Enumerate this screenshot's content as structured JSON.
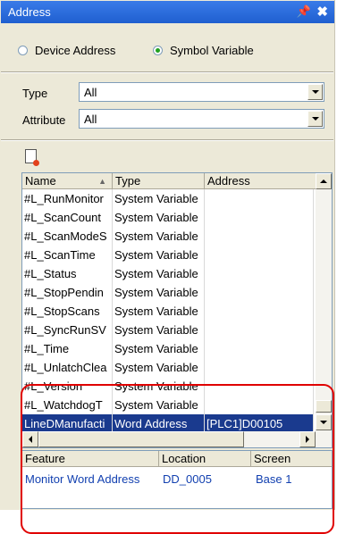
{
  "window": {
    "title": "Address",
    "pin_glyph": "↕",
    "close_glyph": "✕"
  },
  "radios": [
    {
      "label": "Device Address",
      "checked": false
    },
    {
      "label": "Symbol Variable",
      "checked": true
    }
  ],
  "filters": {
    "type_label": "Type",
    "type_value": "All",
    "attribute_label": "Attribute",
    "attribute_value": "All"
  },
  "table": {
    "columns": [
      "Name",
      "Type",
      "Address"
    ],
    "rows": [
      {
        "name": "#L_RunMonitor",
        "type": "System Variable",
        "address": ""
      },
      {
        "name": "#L_ScanCount",
        "type": "System Variable",
        "address": ""
      },
      {
        "name": "#L_ScanModeS",
        "type": "System Variable",
        "address": ""
      },
      {
        "name": "#L_ScanTime",
        "type": "System Variable",
        "address": ""
      },
      {
        "name": "#L_Status",
        "type": "System Variable",
        "address": ""
      },
      {
        "name": "#L_StopPendin",
        "type": "System Variable",
        "address": ""
      },
      {
        "name": "#L_StopScans",
        "type": "System Variable",
        "address": ""
      },
      {
        "name": "#L_SyncRunSV",
        "type": "System Variable",
        "address": ""
      },
      {
        "name": "#L_Time",
        "type": "System Variable",
        "address": ""
      },
      {
        "name": "#L_UnlatchClea",
        "type": "System Variable",
        "address": ""
      },
      {
        "name": "#L_Version",
        "type": "System Variable",
        "address": ""
      },
      {
        "name": "#L_WatchdogT",
        "type": "System Variable",
        "address": ""
      },
      {
        "name": "LineDManufacti",
        "type": "Word Address",
        "address": "[PLC1]D00105"
      }
    ]
  },
  "references": {
    "columns": [
      "Feature",
      "Location",
      "Screen"
    ],
    "rows": [
      {
        "feature": "Monitor Word Address",
        "location": "DD_0005",
        "screen": "Base 1"
      }
    ]
  },
  "colors": {
    "title_bar": "#2a6ad8",
    "selection": "#1a3a8e",
    "link": "#1240b0",
    "highlight_border": "#e00000"
  }
}
